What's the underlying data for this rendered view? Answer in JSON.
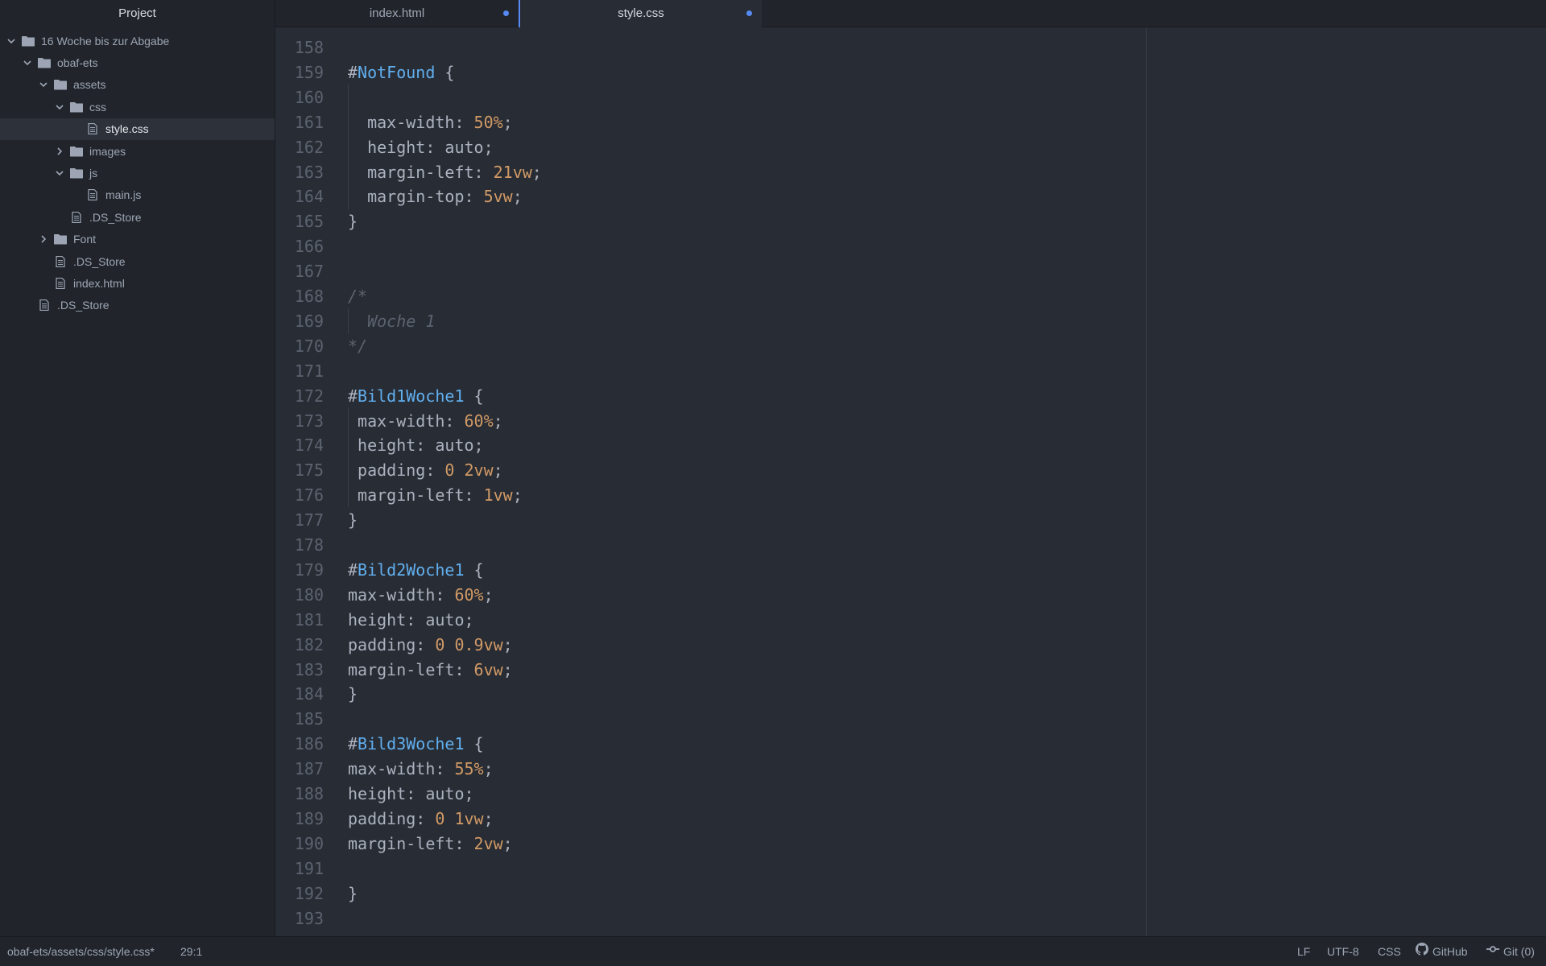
{
  "sidebar": {
    "title": "Project",
    "items": [
      {
        "label": "16 Woche bis zur Abgabe",
        "type": "folder",
        "depth": 0,
        "expanded": true
      },
      {
        "label": "obaf-ets",
        "type": "folder",
        "depth": 1,
        "expanded": true
      },
      {
        "label": "assets",
        "type": "folder",
        "depth": 2,
        "expanded": true
      },
      {
        "label": "css",
        "type": "folder",
        "depth": 3,
        "expanded": true
      },
      {
        "label": "style.css",
        "type": "file",
        "depth": 4,
        "selected": true
      },
      {
        "label": "images",
        "type": "folder",
        "depth": 3,
        "expanded": false
      },
      {
        "label": "js",
        "type": "folder",
        "depth": 3,
        "expanded": true
      },
      {
        "label": "main.js",
        "type": "file",
        "depth": 4
      },
      {
        "label": ".DS_Store",
        "type": "file",
        "depth": 3
      },
      {
        "label": "Font",
        "type": "folder",
        "depth": 2,
        "expanded": false
      },
      {
        "label": ".DS_Store",
        "type": "file",
        "depth": 2
      },
      {
        "label": "index.html",
        "type": "file",
        "depth": 2
      },
      {
        "label": ".DS_Store",
        "type": "file",
        "depth": 1
      }
    ]
  },
  "tabs": [
    {
      "label": "index.html",
      "active": false,
      "modified": true
    },
    {
      "label": "style.css",
      "active": true,
      "modified": true
    }
  ],
  "editor": {
    "lines": [
      {
        "n": "158",
        "tokens": []
      },
      {
        "n": "159",
        "tokens": [
          [
            "hash",
            "#"
          ],
          [
            "id",
            "NotFound"
          ],
          [
            "p",
            " {"
          ]
        ]
      },
      {
        "n": "160",
        "tokens": []
      },
      {
        "n": "161",
        "tokens": [
          [
            "p",
            "  max-width: "
          ],
          [
            "num",
            "50%"
          ],
          [
            "p",
            ";"
          ]
        ]
      },
      {
        "n": "162",
        "tokens": [
          [
            "p",
            "  height: auto;"
          ]
        ]
      },
      {
        "n": "163",
        "tokens": [
          [
            "p",
            "  margin-left: "
          ],
          [
            "num",
            "21vw"
          ],
          [
            "p",
            ";"
          ]
        ]
      },
      {
        "n": "164",
        "tokens": [
          [
            "p",
            "  margin-top: "
          ],
          [
            "num",
            "5vw"
          ],
          [
            "p",
            ";"
          ]
        ]
      },
      {
        "n": "165",
        "tokens": [
          [
            "p",
            "}"
          ]
        ]
      },
      {
        "n": "166",
        "tokens": []
      },
      {
        "n": "167",
        "tokens": []
      },
      {
        "n": "168",
        "tokens": [
          [
            "cmt",
            "/*"
          ]
        ]
      },
      {
        "n": "169",
        "tokens": [
          [
            "cmt",
            "  Woche 1"
          ]
        ]
      },
      {
        "n": "170",
        "tokens": [
          [
            "cmt",
            "*/"
          ]
        ]
      },
      {
        "n": "171",
        "tokens": []
      },
      {
        "n": "172",
        "tokens": [
          [
            "hash",
            "#"
          ],
          [
            "id",
            "Bild1Woche1"
          ],
          [
            "p",
            " {"
          ]
        ]
      },
      {
        "n": "173",
        "tokens": [
          [
            "p",
            " max-width: "
          ],
          [
            "num",
            "60%"
          ],
          [
            "p",
            ";"
          ]
        ]
      },
      {
        "n": "174",
        "tokens": [
          [
            "p",
            " height: auto;"
          ]
        ]
      },
      {
        "n": "175",
        "tokens": [
          [
            "p",
            " padding: "
          ],
          [
            "num",
            "0 2vw"
          ],
          [
            "p",
            ";"
          ]
        ]
      },
      {
        "n": "176",
        "tokens": [
          [
            "p",
            " margin-left: "
          ],
          [
            "num",
            "1vw"
          ],
          [
            "p",
            ";"
          ]
        ]
      },
      {
        "n": "177",
        "tokens": [
          [
            "p",
            "}"
          ]
        ]
      },
      {
        "n": "178",
        "tokens": []
      },
      {
        "n": "179",
        "tokens": [
          [
            "hash",
            "#"
          ],
          [
            "id",
            "Bild2Woche1"
          ],
          [
            "p",
            " {"
          ]
        ]
      },
      {
        "n": "180",
        "tokens": [
          [
            "p",
            "max-width: "
          ],
          [
            "num",
            "60%"
          ],
          [
            "p",
            ";"
          ]
        ]
      },
      {
        "n": "181",
        "tokens": [
          [
            "p",
            "height: auto;"
          ]
        ]
      },
      {
        "n": "182",
        "tokens": [
          [
            "p",
            "padding: "
          ],
          [
            "num",
            "0 0.9vw"
          ],
          [
            "p",
            ";"
          ]
        ]
      },
      {
        "n": "183",
        "tokens": [
          [
            "p",
            "margin-left: "
          ],
          [
            "num",
            "6vw"
          ],
          [
            "p",
            ";"
          ]
        ]
      },
      {
        "n": "184",
        "tokens": [
          [
            "p",
            "}"
          ]
        ]
      },
      {
        "n": "185",
        "tokens": []
      },
      {
        "n": "186",
        "tokens": [
          [
            "hash",
            "#"
          ],
          [
            "id",
            "Bild3Woche1"
          ],
          [
            "p",
            " {"
          ]
        ]
      },
      {
        "n": "187",
        "tokens": [
          [
            "p",
            "max-width: "
          ],
          [
            "num",
            "55%"
          ],
          [
            "p",
            ";"
          ]
        ]
      },
      {
        "n": "188",
        "tokens": [
          [
            "p",
            "height: auto;"
          ]
        ]
      },
      {
        "n": "189",
        "tokens": [
          [
            "p",
            "padding: "
          ],
          [
            "num",
            "0 1vw"
          ],
          [
            "p",
            ";"
          ]
        ]
      },
      {
        "n": "190",
        "tokens": [
          [
            "p",
            "margin-left: "
          ],
          [
            "num",
            "2vw"
          ],
          [
            "p",
            ";"
          ]
        ]
      },
      {
        "n": "191",
        "tokens": []
      },
      {
        "n": "192",
        "tokens": [
          [
            "p",
            "}"
          ]
        ]
      },
      {
        "n": "193",
        "tokens": []
      }
    ]
  },
  "statusbar": {
    "path": "obaf-ets/assets/css/style.css*",
    "cursor": "29:1",
    "line_ending": "LF",
    "encoding": "UTF-8",
    "grammar": "CSS",
    "github": "GitHub",
    "git": "Git (0)"
  },
  "colors": {
    "accent": "#568af2",
    "selector_id": "#61afef",
    "number": "#d19a66",
    "comment": "#5c6370",
    "text": "#abb2bf"
  }
}
